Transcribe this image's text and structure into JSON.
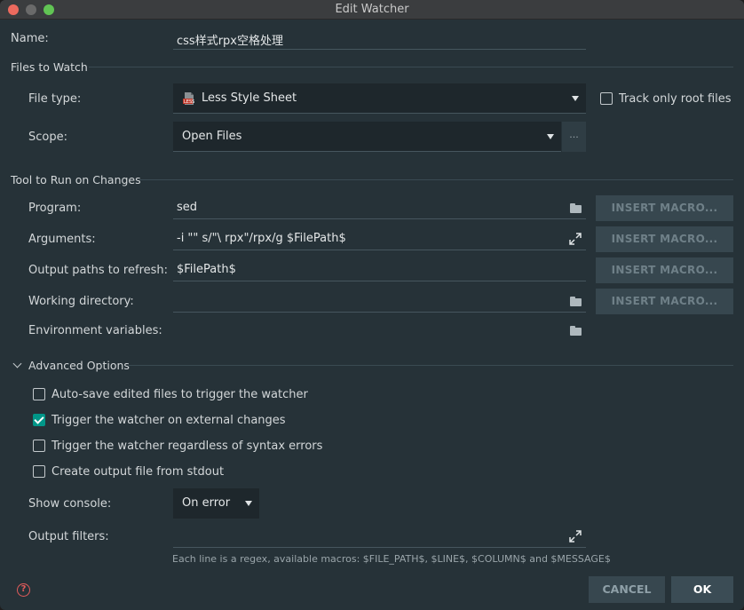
{
  "window": {
    "title": "Edit Watcher"
  },
  "name": {
    "label": "Name:",
    "value": "css样式rpx空格处理"
  },
  "files_to_watch": {
    "section_title": "Files to Watch",
    "file_type_label": "File type:",
    "file_type_value": "Less Style Sheet",
    "file_type_icon": "less-file-icon",
    "track_root_label": "Track only root files",
    "track_root_checked": false,
    "scope_label": "Scope:",
    "scope_value": "Open Files",
    "scope_more": "..."
  },
  "tool": {
    "section_title": "Tool to Run on Changes",
    "program_label": "Program:",
    "program_value": "sed",
    "arguments_label": "Arguments:",
    "arguments_value": "-i \"\" s/\"\\ rpx\"/rpx/g $FilePath$",
    "output_paths_label": "Output paths to refresh:",
    "output_paths_value": "$FilePath$",
    "working_dir_label": "Working directory:",
    "working_dir_value": "",
    "env_vars_label": "Environment variables:",
    "env_vars_value": "",
    "insert_macro_label": "INSERT MACRO..."
  },
  "advanced": {
    "section_title": "Advanced Options",
    "expanded": true,
    "options": [
      {
        "label": "Auto-save edited files to trigger the watcher",
        "checked": false
      },
      {
        "label": "Trigger the watcher on external changes",
        "checked": true
      },
      {
        "label": "Trigger the watcher regardless of syntax errors",
        "checked": false
      },
      {
        "label": "Create output file from stdout",
        "checked": false
      }
    ],
    "show_console_label": "Show console:",
    "show_console_value": "On error",
    "output_filters_label": "Output filters:",
    "output_filters_value": "",
    "output_filters_hint": "Each line is a regex, available macros: $FILE_PATH$, $LINE$, $COLUMN$ and $MESSAGE$"
  },
  "footer": {
    "cancel_label": "CANCEL",
    "ok_label": "OK",
    "help_icon": "question-icon"
  },
  "colors": {
    "background": "#263238",
    "accent": "#009688",
    "button": "#37474f"
  }
}
